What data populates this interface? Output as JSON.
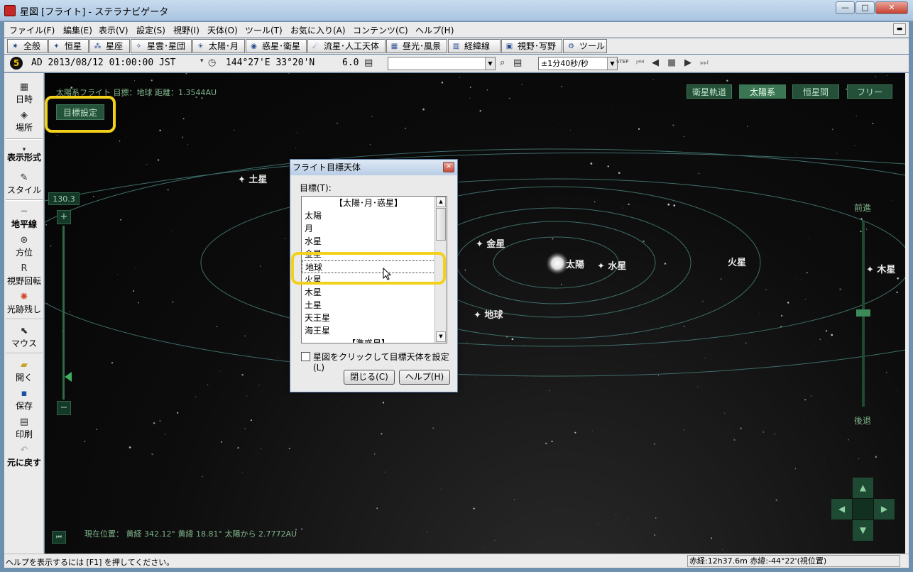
{
  "window": {
    "title": "星図 [フライト] - ステラナビゲータ",
    "min": "—",
    "max": "□",
    "close": "✕"
  },
  "menu": [
    "ファイル(F)",
    "編集(E)",
    "表示(V)",
    "設定(S)",
    "視野(I)",
    "天体(O)",
    "ツール(T)",
    "お気に入り(A)",
    "コンテンツ(C)",
    "ヘルプ(H)"
  ],
  "tabs": [
    {
      "label": "全般",
      "icon": "✷"
    },
    {
      "label": "恒星",
      "icon": "✦"
    },
    {
      "label": "星座",
      "icon": "⁂"
    },
    {
      "label": "星雲･星団",
      "icon": "✧"
    },
    {
      "label": "太陽･月",
      "icon": "☀"
    },
    {
      "label": "惑星･衛星",
      "icon": "◉"
    },
    {
      "label": "流星･人工天体",
      "icon": "☄"
    },
    {
      "label": "昼光･風景",
      "icon": "▦"
    },
    {
      "label": "経緯線",
      "icon": "▥"
    },
    {
      "label": "視野･写野",
      "icon": "▣"
    },
    {
      "label": "ツール",
      "icon": "⚙"
    }
  ],
  "infobar": {
    "badge": "5",
    "datetime": "AD 2013/08/12 01:00:00 JST",
    "location": "144°27'E 33°20'N",
    "magnitude": "6.0",
    "speed": "±1分40秒/秒",
    "step_label": "STEP"
  },
  "sidebar": [
    {
      "label": "日時",
      "icon": "▦"
    },
    {
      "label": "場所",
      "icon": "◈"
    },
    {
      "label": "表示形式",
      "icon": "▾"
    },
    {
      "label": "スタイル",
      "icon": "✎"
    },
    {
      "label": "地平線",
      "icon": "━"
    },
    {
      "label": "方位",
      "icon": "⊛"
    },
    {
      "label": "視野回転",
      "icon": "R"
    },
    {
      "label": "光跡残し",
      "icon": "✺"
    },
    {
      "label": "マウス",
      "icon": "⬉"
    },
    {
      "label": "開く",
      "icon": "▰"
    },
    {
      "label": "保存",
      "icon": "▪"
    },
    {
      "label": "印刷",
      "icon": "▤"
    },
    {
      "label": "元に戻す",
      "icon": "↶"
    }
  ],
  "sky": {
    "info": "太陽系フライト  目標：地球  距離：1.3544AU",
    "target_button": "目標設定",
    "modes": [
      {
        "label": "衛星軌道",
        "active": false
      },
      {
        "label": "太陽系",
        "active": true
      },
      {
        "label": "恒星間",
        "active": false
      },
      {
        "label": "フリー",
        "active": false
      }
    ],
    "zoom_value": "130.3",
    "zoom_plus": "+",
    "zoom_minus": "−",
    "forward": "前進",
    "backward": "後退",
    "position": "現在位置： 黄経 342.12° 黄緯 18.81° 太陽から 2.7772AU",
    "skip_glyph": "⏮",
    "planets": [
      "土星",
      "金星",
      "太陽",
      "水星",
      "火星",
      "木星",
      "地球"
    ],
    "nav": {
      "up": "▲",
      "down": "▼",
      "left": "◀",
      "right": "▶"
    }
  },
  "dialog": {
    "title": "フライト目標天体",
    "close": "✕",
    "label": "目標(T):",
    "items": [
      "【太陽･月･惑星】",
      "太陽",
      "月",
      "水星",
      "金星",
      "地球",
      "火星",
      "木星",
      "土星",
      "天王星",
      "海王星",
      "【準惑星】"
    ],
    "selected_index": 5,
    "checkbox_label": "星図をクリックして目標天体を設定(L)",
    "close_button": "閉じる(C)",
    "help_button": "ヘルプ(H)"
  },
  "status": {
    "hint": "ヘルプを表示するには [F1] を押してください。",
    "coord": "赤経:12h37.6m  赤緯:-44°22'(視位置)"
  }
}
